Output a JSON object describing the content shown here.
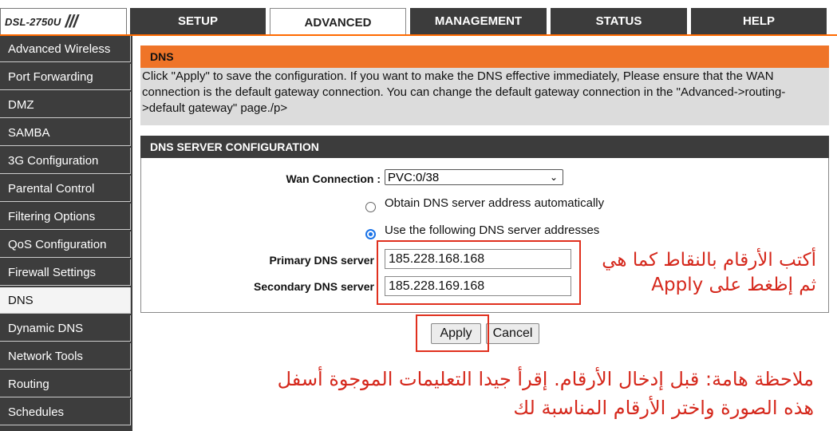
{
  "logo": {
    "name": "DSL-2750U",
    "slashes": "///"
  },
  "tabs": [
    {
      "label": "SETUP"
    },
    {
      "label": "ADVANCED"
    },
    {
      "label": "MANAGEMENT"
    },
    {
      "label": "STATUS"
    },
    {
      "label": "HELP"
    }
  ],
  "sidebar": {
    "items": [
      {
        "label": "Advanced Wireless"
      },
      {
        "label": "Port Forwarding"
      },
      {
        "label": "DMZ"
      },
      {
        "label": "SAMBA"
      },
      {
        "label": "3G Configuration"
      },
      {
        "label": "Parental Control"
      },
      {
        "label": "Filtering Options"
      },
      {
        "label": "QoS Configuration"
      },
      {
        "label": "Firewall Settings"
      },
      {
        "label": "DNS"
      },
      {
        "label": "Dynamic DNS"
      },
      {
        "label": "Network Tools"
      },
      {
        "label": "Routing"
      },
      {
        "label": "Schedules"
      }
    ]
  },
  "dns": {
    "title": "DNS",
    "description": "Click \"Apply\" to save the configuration. If you want to make the DNS effective immediately, Please ensure that the WAN connection is the default gateway connection. You can change the default gateway connection in the \"Advanced->routing->default gateway\" page./p>",
    "section_title": "DNS SERVER CONFIGURATION",
    "wan_label": "Wan Connection :",
    "wan_value": "PVC:0/38",
    "radio_auto": "Obtain DNS server address automatically",
    "radio_manual": "Use the following DNS server addresses",
    "primary_label": "Primary DNS server",
    "primary_value": "185.228.168.168",
    "secondary_label": "Secondary DNS server",
    "secondary_value": "185.228.169.168",
    "apply": "Apply",
    "cancel": "Cancel"
  },
  "annotations": {
    "hint_line1": "أكتب الأرقام بالنقاط كما هي",
    "hint_line2": "ثم إظغط على Apply",
    "note_line1": "ملاحظة هامة: قبل إدخال الأرقام. إقرأ جيدا التعليمات الموجوة أسفل",
    "note_line2": "هذه الصورة واختر الأرقام المناسبة لك"
  },
  "colors": {
    "accent": "#ef7428",
    "dark": "#3c3c3c",
    "annotation": "#d5281c"
  }
}
